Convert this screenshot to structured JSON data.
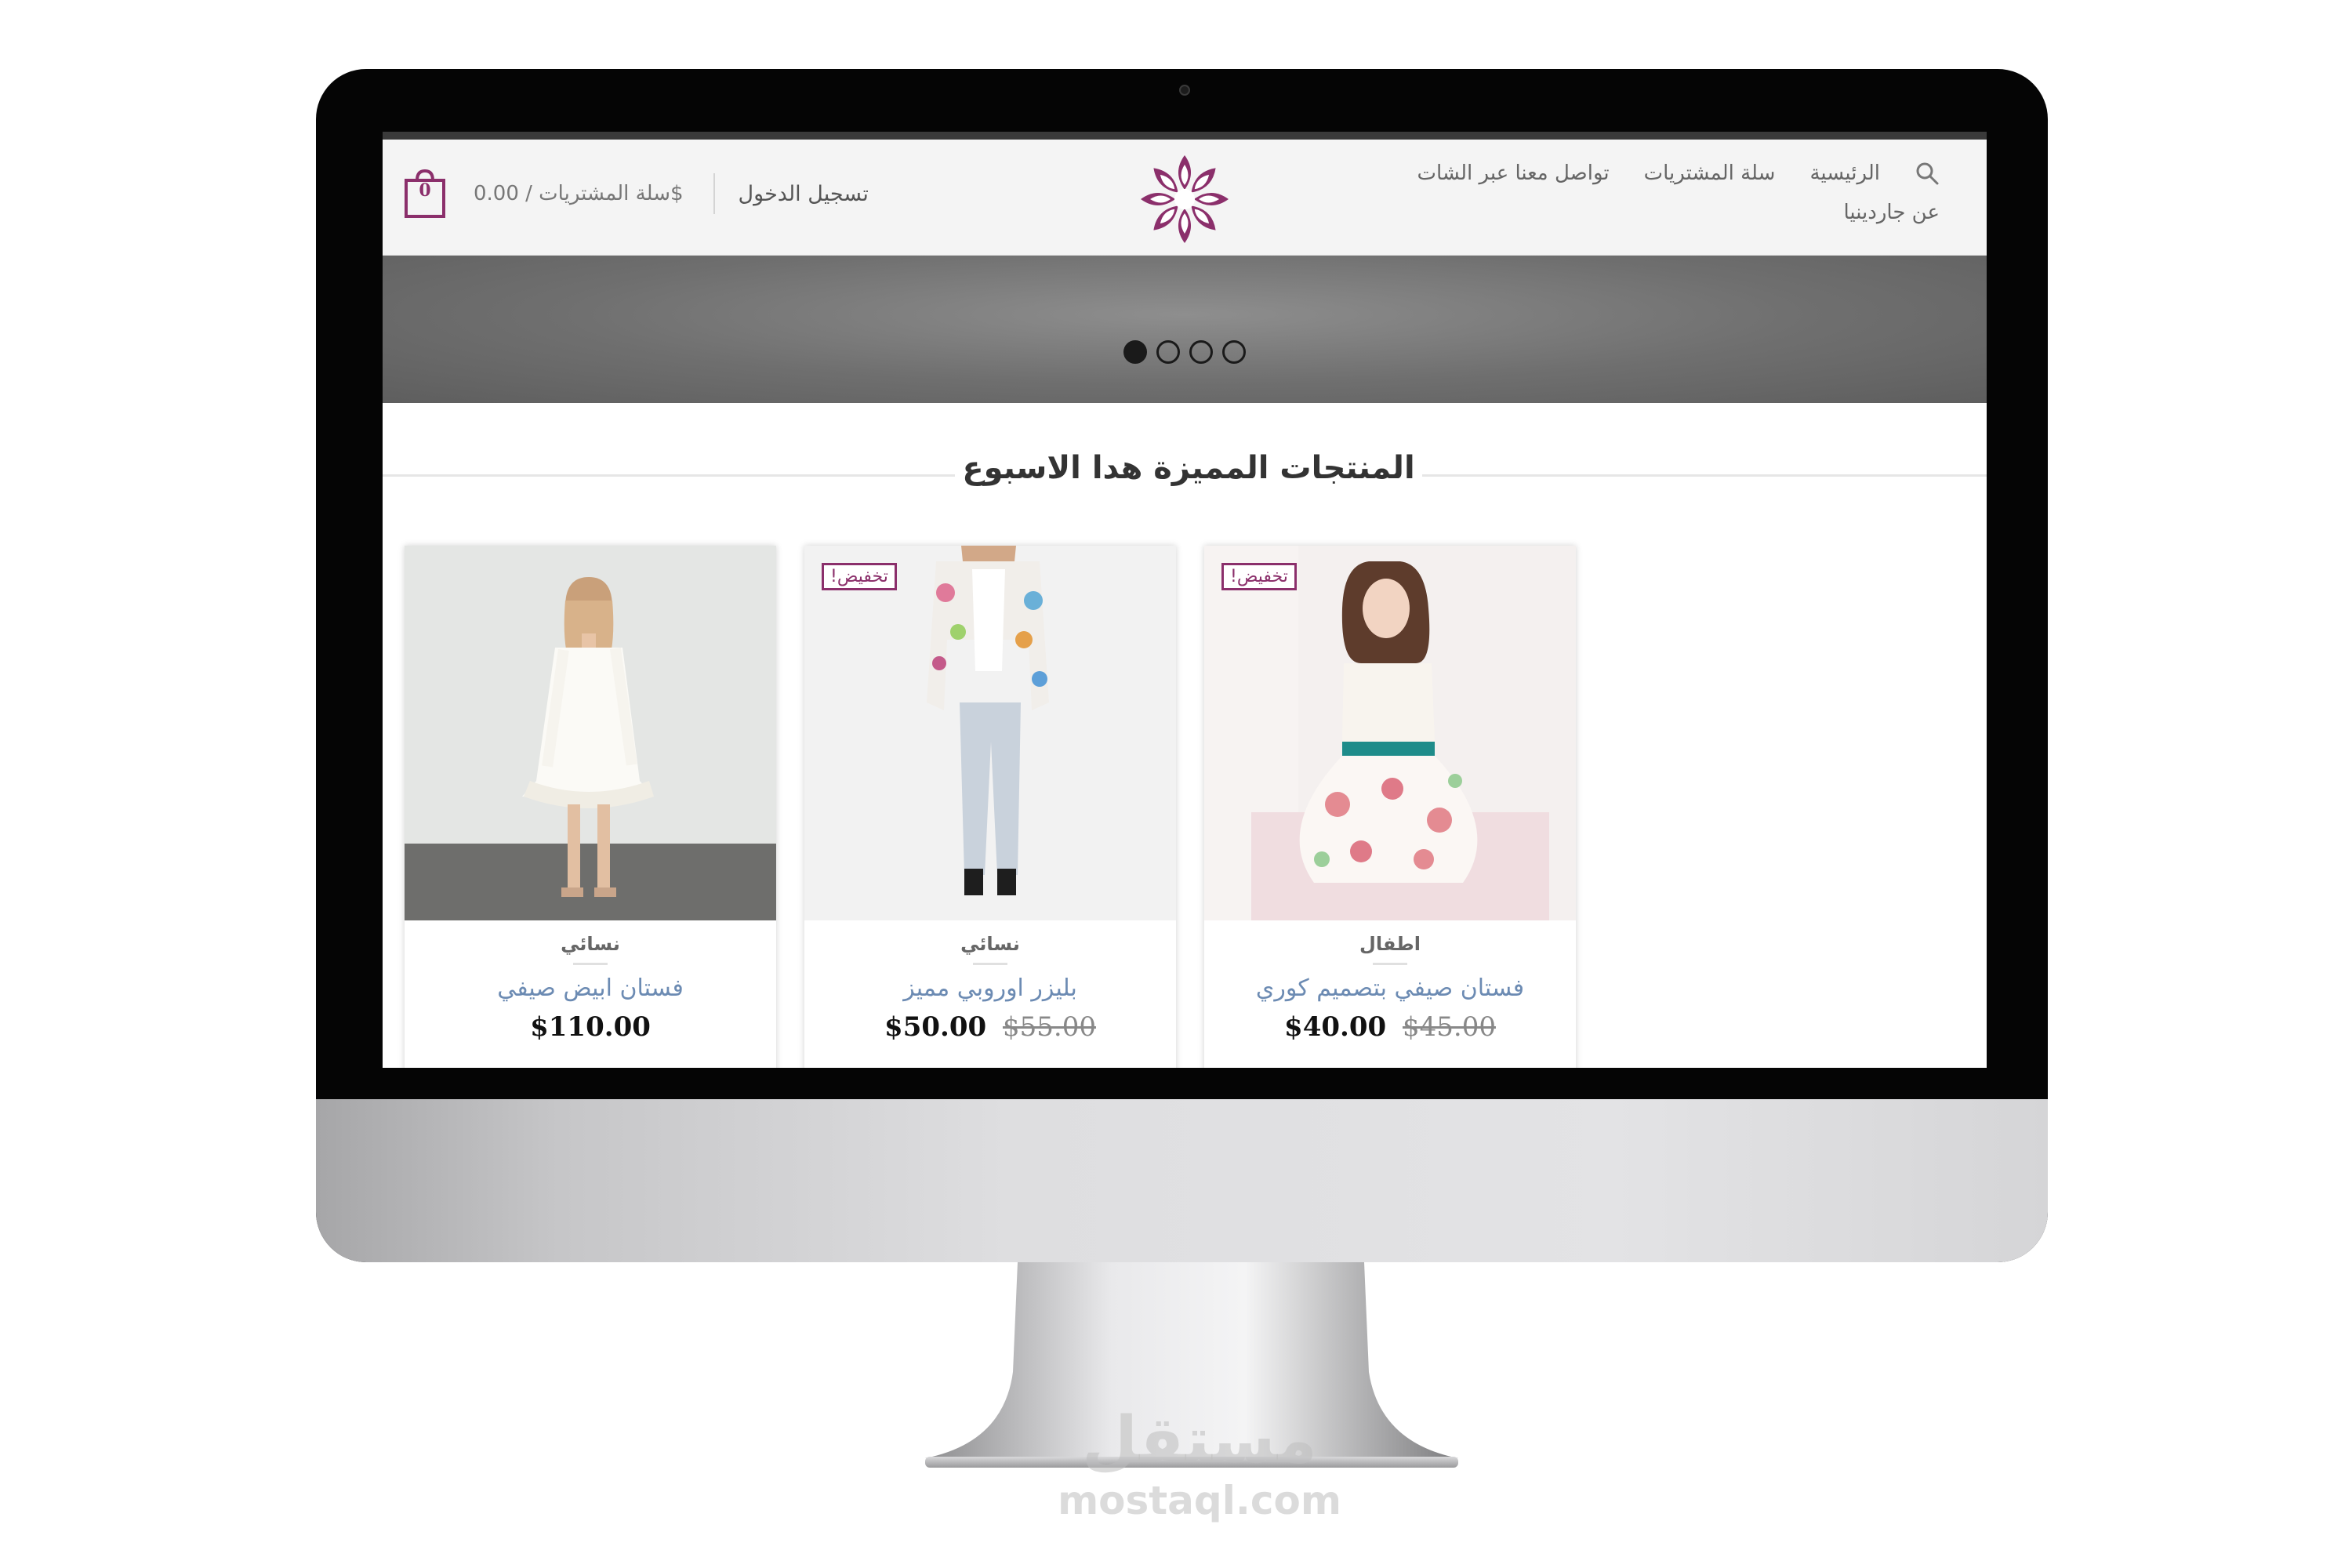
{
  "nav": {
    "items": [
      "الرئيسية",
      "سلة المشتريات",
      "تواصل معنا عبر الشات"
    ],
    "about": "عن جاردينيا",
    "search_icon": "search-icon"
  },
  "account": {
    "cart_count": "0",
    "cart_label": "سلة المشتريات / 0.00$",
    "login": "تسجيل الدخول"
  },
  "brand": {
    "accent": "#8b2f6b",
    "logo_icon": "flower-logo"
  },
  "slider": {
    "dot_count": 4,
    "active_index": 0
  },
  "featured": {
    "title": "المنتجات المميزة هدا الاسبوع",
    "products": [
      {
        "category": "نسائي",
        "name": "فستان ابيض صيفي",
        "price": "$110.00",
        "old_price": "",
        "badge": ""
      },
      {
        "category": "نسائي",
        "name": "بليزر اوروبي مميز",
        "price": "$50.00",
        "old_price": "$55.00",
        "badge": "تخفيض!"
      },
      {
        "category": "اطفال",
        "name": "فستان صيفي بتصميم كوري",
        "price": "$40.00",
        "old_price": "$45.00",
        "badge": "تخفيض!"
      }
    ]
  },
  "watermark": {
    "arabic": "مستقل",
    "domain": "mostaql.com"
  }
}
